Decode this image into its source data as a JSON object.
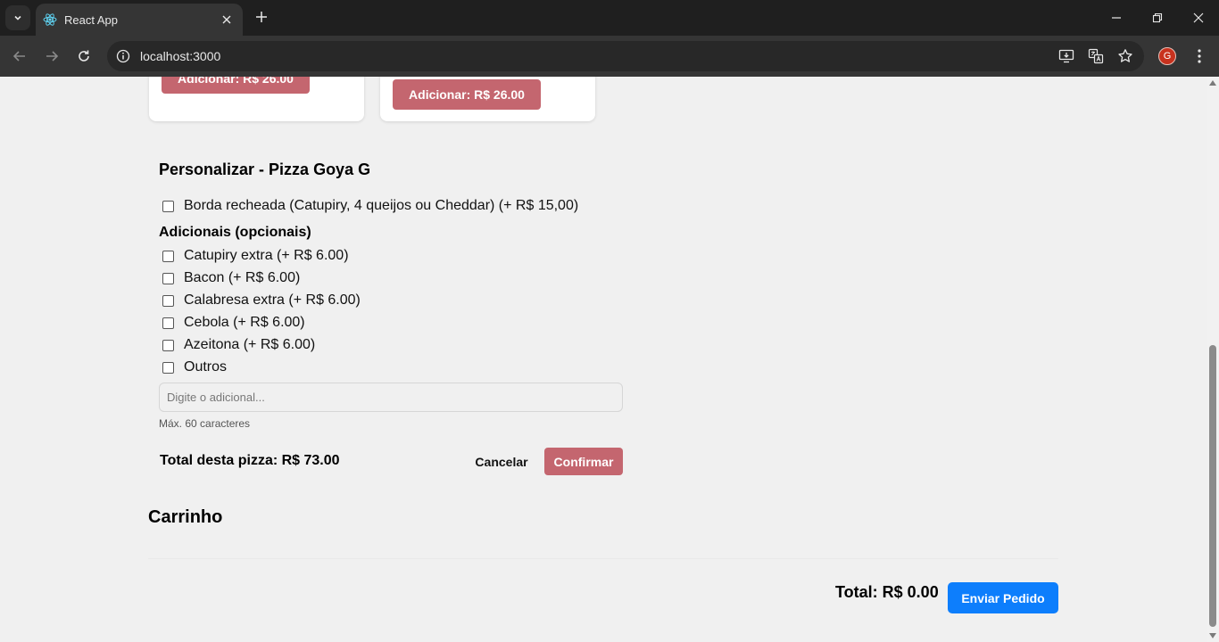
{
  "browser": {
    "tab_title": "React App",
    "url": "localhost:3000",
    "avatar_letter": "G"
  },
  "products": [
    {
      "add_label": "Adicionar: R$ 26.00"
    },
    {
      "add_label": "Adicionar: R$ 26.00"
    }
  ],
  "customize": {
    "title": "Personalizar - Pizza Goya G",
    "crust_option": "Borda recheada (Catupiry, 4 queijos ou Cheddar) (+ R$ 15,00)",
    "extras_label": "Adicionais (opcionais)",
    "extras": [
      "Catupiry extra (+ R$ 6.00)",
      "Bacon (+ R$ 6.00)",
      "Calabresa extra (+ R$ 6.00)",
      "Cebola (+ R$ 6.00)",
      "Azeitona (+ R$ 6.00)",
      "Outros"
    ],
    "other_placeholder": "Digite o adicional...",
    "hint": "Máx. 60 caracteres",
    "total_label": "Total desta pizza: R$ 73.00",
    "cancel_label": "Cancelar",
    "confirm_label": "Confirmar"
  },
  "cart": {
    "title": "Carrinho",
    "total_label": "Total: R$ 0.00",
    "send_label": "Enviar Pedido"
  },
  "colors": {
    "accent": "#c4666f",
    "primary": "#0d7efc",
    "background": "#f0f0f0"
  }
}
